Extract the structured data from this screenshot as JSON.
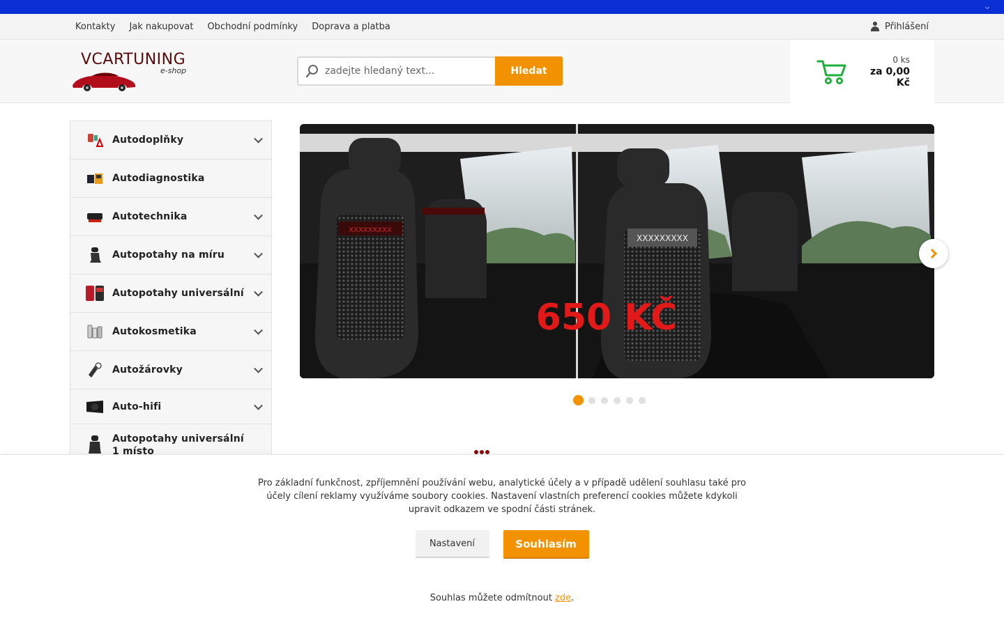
{
  "utility_nav": {
    "links": [
      "Kontakty",
      "Jak nakupovat",
      "Obchodní podmínky",
      "Doprava a platba"
    ],
    "login_label": "Přihlášení"
  },
  "logo": {
    "brand": "VCARTUNING",
    "tagline": "e-shop"
  },
  "search": {
    "placeholder": "zadejte hledaný text...",
    "button_label": "Hledat"
  },
  "cart": {
    "quantity": "0 ks",
    "total": "za 0,00 Kč"
  },
  "sidebar": {
    "items": [
      {
        "label": "Autodoplňky",
        "icon": "accessories-icon",
        "expandable": true
      },
      {
        "label": "Autodiagnostika",
        "icon": "diagnostics-icon",
        "expandable": false
      },
      {
        "label": "Autotechnika",
        "icon": "car-tech-icon",
        "expandable": true
      },
      {
        "label": "Autopotahy na míru",
        "icon": "seat-cover-icon",
        "expandable": true
      },
      {
        "label": "Autopotahy universální",
        "icon": "universal-seat-cover-icon",
        "expandable": true
      },
      {
        "label": "Autokosmetika",
        "icon": "car-cosmetics-icon",
        "expandable": true
      },
      {
        "label": "Autožárovky",
        "icon": "car-bulb-icon",
        "expandable": true
      },
      {
        "label": "Auto-hifi",
        "icon": "subwoofer-icon",
        "expandable": true
      },
      {
        "label": "Autopotahy universální 1 místo",
        "icon": "single-seat-cover-icon",
        "expandable": false
      }
    ]
  },
  "slider": {
    "price_label": "650 KČ",
    "seat_pattern": "XXXXXXXXX",
    "slide_count": 6,
    "active_slide": 1
  },
  "cookie_bar": {
    "message": "Pro základní funkčnost, zpříjemnění používání webu, analytické účely a v případě udělení souhlasu také pro účely cílení reklamy využíváme soubory cookies. Nastavení vlastních preferencí cookies můžete kdykoli upravit odkazem ve spodní části stránek.",
    "settings_label": "Nastavení",
    "agree_label": "Souhlasím",
    "decline_prefix": "Souhlas můžete odmítnout ",
    "decline_link": "zde",
    "decline_suffix": "."
  },
  "colors": {
    "accent": "#f39200",
    "top_strip": "#0a2fd4",
    "cart_green": "#1fae3a",
    "brand_dark_red": "#5a0a0a"
  }
}
